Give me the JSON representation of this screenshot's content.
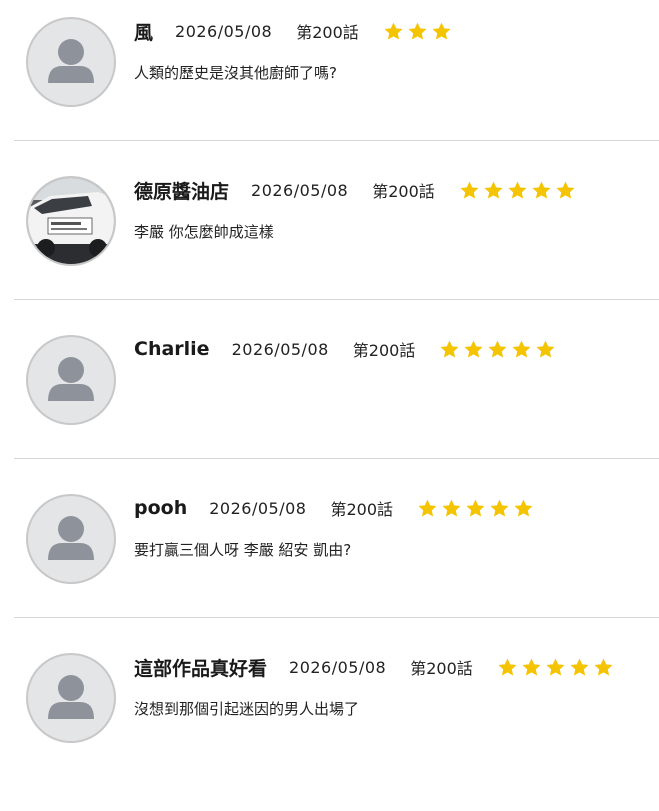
{
  "comments": [
    {
      "name": "風",
      "date": "2026/05/08",
      "episode": "第200話",
      "rating": 3,
      "text": "人類的歷史是沒其他廚師了嗎?",
      "avatar": "default-avatar"
    },
    {
      "name": "德原醬油店",
      "date": "2026/05/08",
      "episode": "第200話",
      "rating": 5,
      "text": "李嚴 你怎麼帥成這樣",
      "avatar": "car-photo-avatar"
    },
    {
      "name": "Charlie",
      "date": "2026/05/08",
      "episode": "第200話",
      "rating": 5,
      "text": "",
      "avatar": "default-avatar"
    },
    {
      "name": "pooh",
      "date": "2026/05/08",
      "episode": "第200話",
      "rating": 5,
      "text": "要打贏三個人呀 李嚴 紹安 凱由?",
      "avatar": "default-avatar"
    },
    {
      "name": "這部作品真好看",
      "date": "2026/05/08",
      "episode": "第200話",
      "rating": 5,
      "text": "沒想到那個引起迷因的男人出場了",
      "avatar": "default-avatar"
    }
  ],
  "colors": {
    "star": "#f5c400",
    "divider": "#d6d6d6",
    "avatar_bg": "#e4e5e7",
    "avatar_figure": "#8e939b"
  }
}
